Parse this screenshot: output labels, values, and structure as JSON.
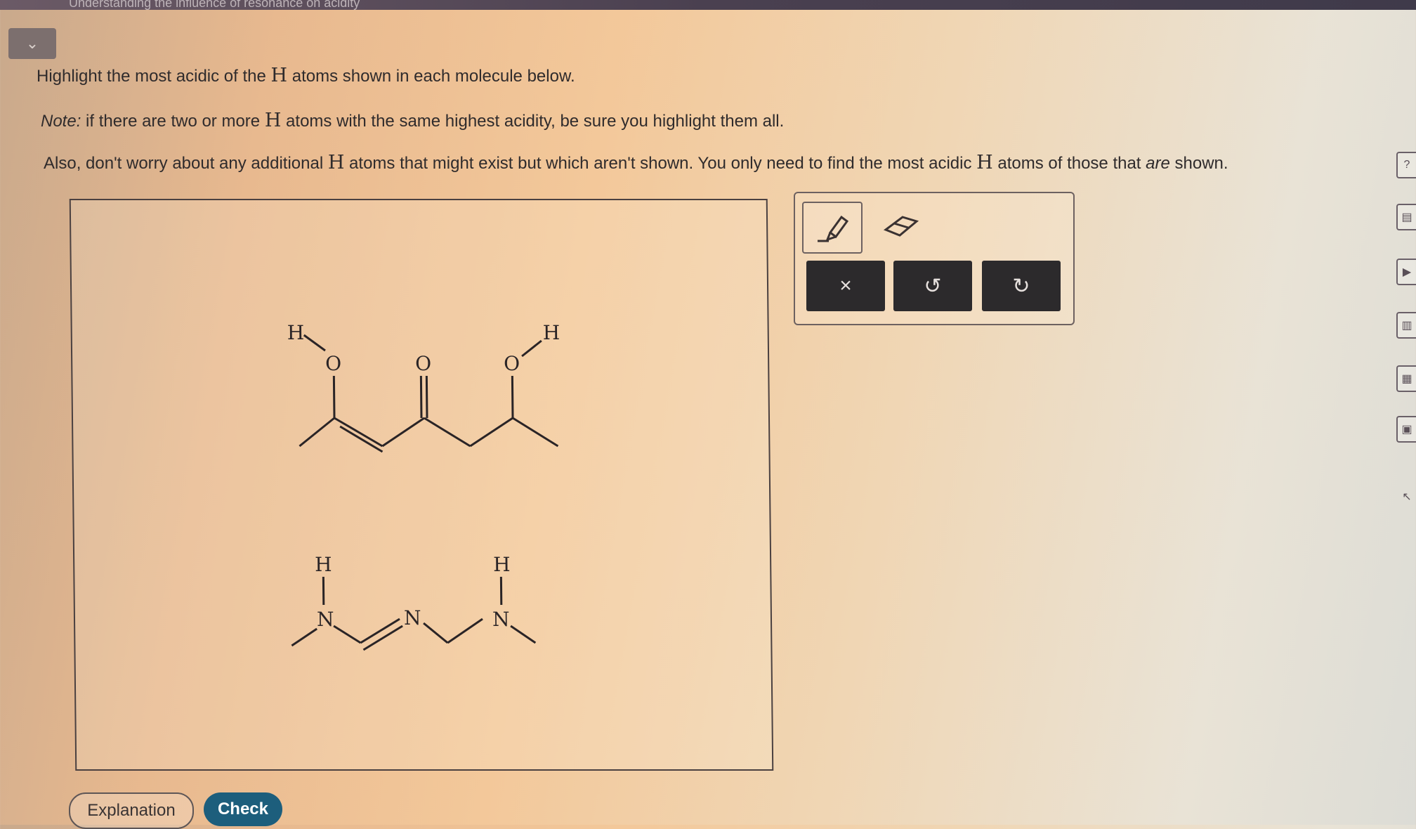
{
  "header": {
    "title": "Understanding the influence of resonance on acidity",
    "collapse_icon": "chevron-down-icon"
  },
  "instructions": {
    "line1_pre": "Highlight the most acidic of the",
    "line1_H": "H",
    "line1_post": "atoms shown in each molecule below.",
    "line2_note": "Note:",
    "line2_pre": "if there are two or more",
    "line2_H": "H",
    "line2_post": "atoms with the same highest acidity, be sure you highlight them all.",
    "line3_pre": "Also, don't worry about any additional",
    "line3_H": "H",
    "line3_mid": "atoms that might exist but which aren't shown. You only need to find the most acidic",
    "line3_H2": "H",
    "line3_post": "atoms of those that",
    "line3_em": "are",
    "line3_end": "shown."
  },
  "molecule1": {
    "h_left": "H",
    "o_left": "O",
    "o_mid": "O",
    "o_right": "O",
    "h_right": "H"
  },
  "molecule2": {
    "h_left": "H",
    "n_left": "N",
    "n_mid": "N",
    "n_right": "N",
    "h_right": "H"
  },
  "toolbar": {
    "highlight_tool_icon": "highlighter-icon",
    "eraser_tool_icon": "eraser-icon",
    "clear_label": "×",
    "undo_label": "↺",
    "redo_label": "↻"
  },
  "side_icons": [
    "help-icon",
    "calculator-icon",
    "video-icon",
    "chart-icon",
    "periodic-table-icon",
    "data-icon",
    "cursor-icon"
  ],
  "buttons": {
    "explanation": "Explanation",
    "check": "Check"
  },
  "colors": {
    "check_button": "#1d5e7c",
    "toolbar_button": "#2c2a2c",
    "text": "#2f2b2c"
  }
}
